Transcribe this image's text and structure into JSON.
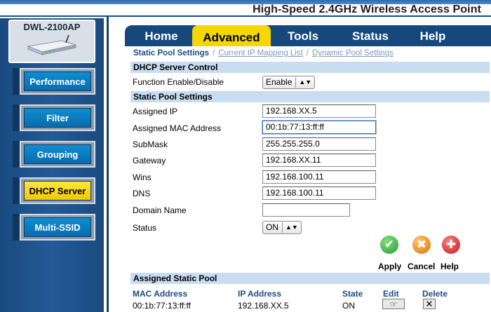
{
  "header": {
    "title": "High-Speed 2.4GHz Wireless Access Point"
  },
  "sidebar": {
    "model": "DWL-2100AP",
    "items": [
      {
        "label": "Performance",
        "active": false
      },
      {
        "label": "Filter",
        "active": false
      },
      {
        "label": "Grouping",
        "active": false
      },
      {
        "label": "DHCP Server",
        "active": true
      },
      {
        "label": "Multi-SSID",
        "active": false
      }
    ]
  },
  "tabs": [
    {
      "label": "Home",
      "active": false
    },
    {
      "label": "Advanced",
      "active": true
    },
    {
      "label": "Tools",
      "active": false
    },
    {
      "label": "Status",
      "active": false
    },
    {
      "label": "Help",
      "active": false
    }
  ],
  "subnav": {
    "current": "Static Pool Settings",
    "links": [
      "Current IP Mapping List",
      "Dynamic Pool Settings"
    ],
    "separator": "/"
  },
  "dhcp_control": {
    "section_title": "DHCP Server Control",
    "function_label": "Function Enable/Disable",
    "function_value": "Enable"
  },
  "static_pool": {
    "section_title": "Static Pool Settings",
    "assigned_ip": {
      "label": "Assigned IP",
      "value": "192.168.XX.5"
    },
    "assigned_mac": {
      "label": "Assigned MAC Address",
      "value": "00:1b:77:13:ff:ff"
    },
    "submask": {
      "label": "SubMask",
      "value": "255.255.255.0"
    },
    "gateway": {
      "label": "Gateway",
      "value": "192.168.XX.11"
    },
    "wins": {
      "label": "Wins",
      "value": "192.168.100.11"
    },
    "dns": {
      "label": "DNS",
      "value": "192.168.100.11"
    },
    "domain_name": {
      "label": "Domain Name",
      "value": ""
    },
    "status": {
      "label": "Status",
      "value": "ON"
    }
  },
  "actions": {
    "apply": "Apply",
    "cancel": "Cancel",
    "help": "Help"
  },
  "assigned_pool": {
    "section_title": "Assigned Static Pool",
    "headers": {
      "mac": "MAC Address",
      "ip": "IP Address",
      "state": "State",
      "edit": "Edit",
      "delete": "Delete"
    },
    "rows": [
      {
        "mac": "00:1b:77:13:ff:ff",
        "ip": "192.168.XX.5",
        "state": "ON"
      }
    ]
  },
  "colors": {
    "brand_blue": "#16487c",
    "active_yellow": "#f4d700",
    "section_bar": "#c8dcf2",
    "apply_green": "#3bb54a",
    "cancel_orange": "#f08a1c",
    "help_red": "#e03030"
  },
  "icons": {
    "apply": "check-icon",
    "cancel": "x-icon",
    "help": "plus-icon",
    "edit": "pointing-hand-icon",
    "delete": "x-icon"
  }
}
